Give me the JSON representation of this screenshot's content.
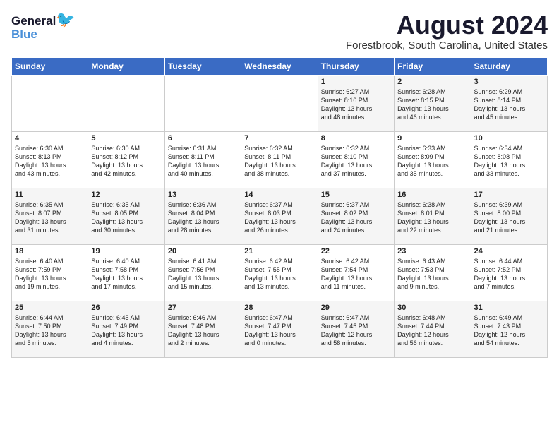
{
  "header": {
    "logo_line1": "General",
    "logo_line2": "Blue",
    "month_title": "August 2024",
    "location": "Forestbrook, South Carolina, United States"
  },
  "days_of_week": [
    "Sunday",
    "Monday",
    "Tuesday",
    "Wednesday",
    "Thursday",
    "Friday",
    "Saturday"
  ],
  "weeks": [
    [
      {
        "day": "",
        "info": ""
      },
      {
        "day": "",
        "info": ""
      },
      {
        "day": "",
        "info": ""
      },
      {
        "day": "",
        "info": ""
      },
      {
        "day": "1",
        "info": "Sunrise: 6:27 AM\nSunset: 8:16 PM\nDaylight: 13 hours\nand 48 minutes."
      },
      {
        "day": "2",
        "info": "Sunrise: 6:28 AM\nSunset: 8:15 PM\nDaylight: 13 hours\nand 46 minutes."
      },
      {
        "day": "3",
        "info": "Sunrise: 6:29 AM\nSunset: 8:14 PM\nDaylight: 13 hours\nand 45 minutes."
      }
    ],
    [
      {
        "day": "4",
        "info": "Sunrise: 6:30 AM\nSunset: 8:13 PM\nDaylight: 13 hours\nand 43 minutes."
      },
      {
        "day": "5",
        "info": "Sunrise: 6:30 AM\nSunset: 8:12 PM\nDaylight: 13 hours\nand 42 minutes."
      },
      {
        "day": "6",
        "info": "Sunrise: 6:31 AM\nSunset: 8:11 PM\nDaylight: 13 hours\nand 40 minutes."
      },
      {
        "day": "7",
        "info": "Sunrise: 6:32 AM\nSunset: 8:11 PM\nDaylight: 13 hours\nand 38 minutes."
      },
      {
        "day": "8",
        "info": "Sunrise: 6:32 AM\nSunset: 8:10 PM\nDaylight: 13 hours\nand 37 minutes."
      },
      {
        "day": "9",
        "info": "Sunrise: 6:33 AM\nSunset: 8:09 PM\nDaylight: 13 hours\nand 35 minutes."
      },
      {
        "day": "10",
        "info": "Sunrise: 6:34 AM\nSunset: 8:08 PM\nDaylight: 13 hours\nand 33 minutes."
      }
    ],
    [
      {
        "day": "11",
        "info": "Sunrise: 6:35 AM\nSunset: 8:07 PM\nDaylight: 13 hours\nand 31 minutes."
      },
      {
        "day": "12",
        "info": "Sunrise: 6:35 AM\nSunset: 8:05 PM\nDaylight: 13 hours\nand 30 minutes."
      },
      {
        "day": "13",
        "info": "Sunrise: 6:36 AM\nSunset: 8:04 PM\nDaylight: 13 hours\nand 28 minutes."
      },
      {
        "day": "14",
        "info": "Sunrise: 6:37 AM\nSunset: 8:03 PM\nDaylight: 13 hours\nand 26 minutes."
      },
      {
        "day": "15",
        "info": "Sunrise: 6:37 AM\nSunset: 8:02 PM\nDaylight: 13 hours\nand 24 minutes."
      },
      {
        "day": "16",
        "info": "Sunrise: 6:38 AM\nSunset: 8:01 PM\nDaylight: 13 hours\nand 22 minutes."
      },
      {
        "day": "17",
        "info": "Sunrise: 6:39 AM\nSunset: 8:00 PM\nDaylight: 13 hours\nand 21 minutes."
      }
    ],
    [
      {
        "day": "18",
        "info": "Sunrise: 6:40 AM\nSunset: 7:59 PM\nDaylight: 13 hours\nand 19 minutes."
      },
      {
        "day": "19",
        "info": "Sunrise: 6:40 AM\nSunset: 7:58 PM\nDaylight: 13 hours\nand 17 minutes."
      },
      {
        "day": "20",
        "info": "Sunrise: 6:41 AM\nSunset: 7:56 PM\nDaylight: 13 hours\nand 15 minutes."
      },
      {
        "day": "21",
        "info": "Sunrise: 6:42 AM\nSunset: 7:55 PM\nDaylight: 13 hours\nand 13 minutes."
      },
      {
        "day": "22",
        "info": "Sunrise: 6:42 AM\nSunset: 7:54 PM\nDaylight: 13 hours\nand 11 minutes."
      },
      {
        "day": "23",
        "info": "Sunrise: 6:43 AM\nSunset: 7:53 PM\nDaylight: 13 hours\nand 9 minutes."
      },
      {
        "day": "24",
        "info": "Sunrise: 6:44 AM\nSunset: 7:52 PM\nDaylight: 13 hours\nand 7 minutes."
      }
    ],
    [
      {
        "day": "25",
        "info": "Sunrise: 6:44 AM\nSunset: 7:50 PM\nDaylight: 13 hours\nand 5 minutes."
      },
      {
        "day": "26",
        "info": "Sunrise: 6:45 AM\nSunset: 7:49 PM\nDaylight: 13 hours\nand 4 minutes."
      },
      {
        "day": "27",
        "info": "Sunrise: 6:46 AM\nSunset: 7:48 PM\nDaylight: 13 hours\nand 2 minutes."
      },
      {
        "day": "28",
        "info": "Sunrise: 6:47 AM\nSunset: 7:47 PM\nDaylight: 13 hours\nand 0 minutes."
      },
      {
        "day": "29",
        "info": "Sunrise: 6:47 AM\nSunset: 7:45 PM\nDaylight: 12 hours\nand 58 minutes."
      },
      {
        "day": "30",
        "info": "Sunrise: 6:48 AM\nSunset: 7:44 PM\nDaylight: 12 hours\nand 56 minutes."
      },
      {
        "day": "31",
        "info": "Sunrise: 6:49 AM\nSunset: 7:43 PM\nDaylight: 12 hours\nand 54 minutes."
      }
    ]
  ]
}
